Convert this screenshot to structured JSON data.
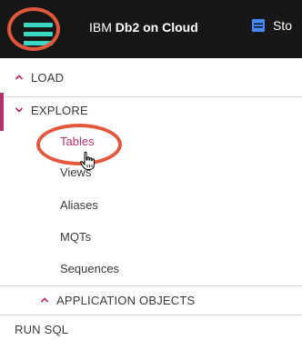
{
  "topbar": {
    "menu_icon": "hamburger-menu-icon",
    "brand_prefix": "IBM",
    "brand_name": "Db2 on Cloud",
    "link_icon": "database-icon",
    "link_label": "Sto"
  },
  "nav": {
    "load": {
      "label": "LOAD",
      "icon": "chevron-up-icon"
    },
    "explore": {
      "label": "EXPLORE",
      "icon": "chevron-down-icon",
      "items": [
        {
          "label": "Tables"
        },
        {
          "label": "Views"
        },
        {
          "label": "Aliases"
        },
        {
          "label": "MQTs"
        },
        {
          "label": "Sequences"
        }
      ]
    },
    "app_objects": {
      "label": "APPLICATION OBJECTS",
      "icon": "chevron-up-icon"
    },
    "run_sql": {
      "label": "RUN SQL"
    }
  },
  "colors": {
    "topbar_bg": "#171717",
    "hamburger": "#3dd6c1",
    "accent": "#b7306e",
    "highlight_ring": "#e2583e",
    "db_icon": "#4589ff"
  }
}
